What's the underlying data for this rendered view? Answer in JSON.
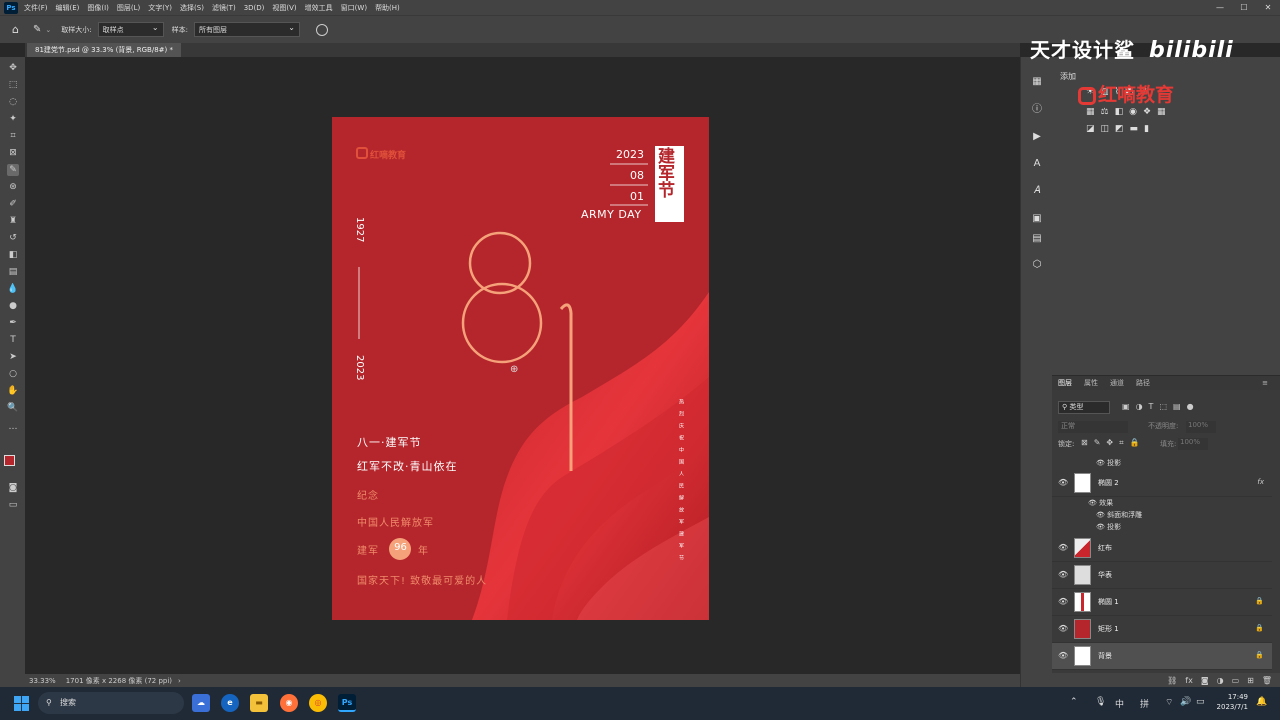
{
  "menu": {
    "items": [
      "文件(F)",
      "编辑(E)",
      "图像(I)",
      "图层(L)",
      "文字(Y)",
      "选择(S)",
      "滤镜(T)",
      "3D(D)",
      "视图(V)",
      "增效工具",
      "窗口(W)",
      "帮助(H)"
    ],
    "logo": "Ps"
  },
  "options": {
    "sample_size_label": "取样大小:",
    "sample_size_value": "取样点",
    "sample_label": "样本:",
    "sample_value": "所有图层"
  },
  "document": {
    "tab_title": "81建党节.psd @ 33.3% (背景, RGB/8#) *"
  },
  "status": {
    "zoom": "33.33%",
    "size": "1701 像素 x 2268 像素 (72 ppi)"
  },
  "poster": {
    "brand": "红嘀教育",
    "year": "2023",
    "month": "08",
    "day": "01",
    "army_day": "ARMY DAY",
    "vertical_title": "建军节",
    "years_from": "1927",
    "years_to": "2023",
    "big_digits": "81",
    "line1": "八一·建军节",
    "line2": "红军不改·青山依在",
    "line3": "纪念",
    "line4": "中国人民解放军",
    "line5_pre": "建军",
    "line5_num": "96",
    "line5_post": "年",
    "line6": "国家天下!  致敬最可爱的人",
    "vertical_small": "热烈庆祝中国人民解放军建军节"
  },
  "layers_panel": {
    "tabs": [
      "图层",
      "属性",
      "通道",
      "路径"
    ],
    "filter_kind": "类型",
    "blend_mode": "正常",
    "opacity_label": "不透明度:",
    "opacity_value": "100%",
    "lock_label": "锁定:",
    "fill_label": "填充:",
    "fill_value": "100%",
    "layers": [
      {
        "name": "椭圆 2",
        "fx": "fx"
      },
      {
        "name": "红布"
      },
      {
        "name": "华表"
      },
      {
        "name": "椭圆 1"
      },
      {
        "name": "矩形 1"
      },
      {
        "name": "背景"
      }
    ],
    "effects_top": "投影",
    "effects_label": "效果",
    "effect_bevel": "斜面和浮雕",
    "effect_shadow": "投影"
  },
  "panel_top": {
    "label": "添加"
  },
  "watermark": {
    "text": "天才设计鲨",
    "site": "bilibili",
    "brand": "红嘀教育"
  },
  "taskbar": {
    "search_placeholder": "搜索",
    "ime1": "中",
    "ime2": "拼",
    "time": "17:49",
    "date": "2023/7/1"
  },
  "colors": {
    "poster_red": "#b4262c",
    "accent_peach": "#f5a27a",
    "ps_blue": "#31a8ff"
  }
}
